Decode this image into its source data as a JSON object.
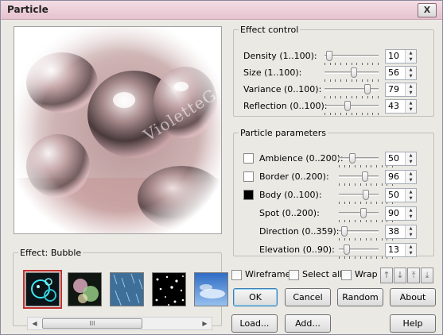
{
  "window": {
    "title": "Particle",
    "close_label": "X"
  },
  "preview": {
    "watermark": "VioletteGraphic"
  },
  "effect": {
    "label": "Effect: Bubble",
    "thumbnails": [
      {
        "name": "Bubble",
        "selected": true
      },
      {
        "name": "Glow",
        "selected": false
      },
      {
        "name": "Rain",
        "selected": false
      },
      {
        "name": "Snow",
        "selected": false
      },
      {
        "name": "Cloud",
        "selected": false
      }
    ],
    "scroll_grip": "III"
  },
  "effect_control": {
    "legend": "Effect control",
    "rows": [
      {
        "label": "Density (1..100):",
        "value": "10",
        "fraction": 0.09
      },
      {
        "label": "Size (1..100):",
        "value": "56",
        "fraction": 0.55
      },
      {
        "label": "Variance (0..100):",
        "value": "79",
        "fraction": 0.79
      },
      {
        "label": "Reflection (0..100):",
        "value": "43",
        "fraction": 0.43
      }
    ]
  },
  "particle_parameters": {
    "legend": "Particle parameters",
    "rows": [
      {
        "label": "Ambience (0..200):",
        "value": "50",
        "fraction": 0.25,
        "swatch": "#ffffff"
      },
      {
        "label": "Border (0..200):",
        "value": "96",
        "fraction": 0.48,
        "swatch": "#ffffff"
      },
      {
        "label": "Body (0..100):",
        "value": "50",
        "fraction": 0.5,
        "swatch": "#000000"
      },
      {
        "label": "Spot (0..200):",
        "value": "90",
        "fraction": 0.45
      },
      {
        "label": "Direction (0..359):",
        "value": "38",
        "fraction": 0.11
      },
      {
        "label": "Elevation (0..90):",
        "value": "13",
        "fraction": 0.14
      }
    ]
  },
  "options": {
    "wireframe": "Wireframe",
    "select_all": "Select all",
    "wrap": "Wrap"
  },
  "order_buttons": [
    {
      "icon": "arrow-up-icon",
      "glyph": "↑"
    },
    {
      "icon": "arrow-down-icon",
      "glyph": "↓"
    },
    {
      "icon": "arrow-top-icon",
      "glyph": "⤒"
    },
    {
      "icon": "arrow-bottom-icon",
      "glyph": "⤓"
    }
  ],
  "buttons": {
    "ok": "OK",
    "cancel": "Cancel",
    "random": "Random",
    "about": "About",
    "load": "Load...",
    "add": "Add...",
    "help": "Help"
  }
}
